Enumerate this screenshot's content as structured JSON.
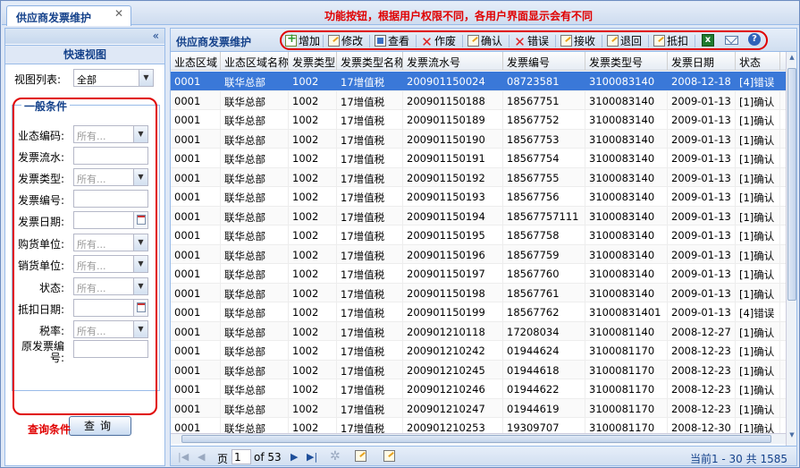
{
  "tab": {
    "title": "供应商发票维护",
    "close": "✕"
  },
  "annotations": {
    "toolbar_note": "功能按钮，根据用户权限不同，各用户界面显示会有不同",
    "query_note": "查询条件"
  },
  "left": {
    "collapse": "«",
    "quick_view_title": "快速视图",
    "view_list_label": "视图列表:",
    "view_list_value": "全部",
    "group_title": "一般条件",
    "fields": [
      {
        "label": "业态编码:",
        "type": "combo",
        "placeholder": "所有..."
      },
      {
        "label": "发票流水:",
        "type": "text"
      },
      {
        "label": "发票类型:",
        "type": "combo",
        "placeholder": "所有..."
      },
      {
        "label": "发票编号:",
        "type": "text"
      },
      {
        "label": "发票日期:",
        "type": "date"
      },
      {
        "label": "购货单位:",
        "type": "combo",
        "placeholder": "所有..."
      },
      {
        "label": "销货单位:",
        "type": "combo",
        "placeholder": "所有..."
      },
      {
        "label": "状态:",
        "type": "combo",
        "placeholder": "所有..."
      },
      {
        "label": "抵扣日期:",
        "type": "date"
      },
      {
        "label": "税率:",
        "type": "combo",
        "placeholder": "所有..."
      },
      {
        "label": "原发票编号:",
        "type": "text"
      }
    ],
    "query_button": "查询"
  },
  "toolbar": {
    "title": "供应商发票维护",
    "buttons": [
      "增加",
      "修改",
      "查看",
      "作废",
      "确认",
      "错误",
      "接收",
      "退回",
      "抵扣"
    ],
    "icons": [
      "excel-icon",
      "mail-icon",
      "help-icon"
    ]
  },
  "grid": {
    "columns": [
      "业态区域",
      "业态区域名称",
      "发票类型",
      "发票类型名称",
      "发票流水号",
      "发票编号",
      "发票类型号",
      "发票日期",
      "状态"
    ],
    "rows": [
      [
        "0001",
        "联华总部",
        "1002",
        "17增值税",
        "200901150024",
        "08723581",
        "3100083140",
        "2008-12-18",
        "[4]错误"
      ],
      [
        "0001",
        "联华总部",
        "1002",
        "17增值税",
        "200901150188",
        "18567751",
        "3100083140",
        "2009-01-13",
        "[1]确认"
      ],
      [
        "0001",
        "联华总部",
        "1002",
        "17增值税",
        "200901150189",
        "18567752",
        "3100083140",
        "2009-01-13",
        "[1]确认"
      ],
      [
        "0001",
        "联华总部",
        "1002",
        "17增值税",
        "200901150190",
        "18567753",
        "3100083140",
        "2009-01-13",
        "[1]确认"
      ],
      [
        "0001",
        "联华总部",
        "1002",
        "17增值税",
        "200901150191",
        "18567754",
        "3100083140",
        "2009-01-13",
        "[1]确认"
      ],
      [
        "0001",
        "联华总部",
        "1002",
        "17增值税",
        "200901150192",
        "18567755",
        "3100083140",
        "2009-01-13",
        "[1]确认"
      ],
      [
        "0001",
        "联华总部",
        "1002",
        "17增值税",
        "200901150193",
        "18567756",
        "3100083140",
        "2009-01-13",
        "[1]确认"
      ],
      [
        "0001",
        "联华总部",
        "1002",
        "17增值税",
        "200901150194",
        "18567757111",
        "3100083140",
        "2009-01-13",
        "[1]确认"
      ],
      [
        "0001",
        "联华总部",
        "1002",
        "17增值税",
        "200901150195",
        "18567758",
        "3100083140",
        "2009-01-13",
        "[1]确认"
      ],
      [
        "0001",
        "联华总部",
        "1002",
        "17增值税",
        "200901150196",
        "18567759",
        "3100083140",
        "2009-01-13",
        "[1]确认"
      ],
      [
        "0001",
        "联华总部",
        "1002",
        "17增值税",
        "200901150197",
        "18567760",
        "3100083140",
        "2009-01-13",
        "[1]确认"
      ],
      [
        "0001",
        "联华总部",
        "1002",
        "17增值税",
        "200901150198",
        "18567761",
        "3100083140",
        "2009-01-13",
        "[1]确认"
      ],
      [
        "0001",
        "联华总部",
        "1002",
        "17增值税",
        "200901150199",
        "18567762",
        "31000831401",
        "2009-01-13",
        "[4]错误"
      ],
      [
        "0001",
        "联华总部",
        "1002",
        "17增值税",
        "200901210118",
        "17208034",
        "3100081140",
        "2008-12-27",
        "[1]确认"
      ],
      [
        "0001",
        "联华总部",
        "1002",
        "17增值税",
        "200901210242",
        "01944624",
        "3100081170",
        "2008-12-23",
        "[1]确认"
      ],
      [
        "0001",
        "联华总部",
        "1002",
        "17增值税",
        "200901210245",
        "01944618",
        "3100081170",
        "2008-12-23",
        "[1]确认"
      ],
      [
        "0001",
        "联华总部",
        "1002",
        "17增值税",
        "200901210246",
        "01944622",
        "3100081170",
        "2008-12-23",
        "[1]确认"
      ],
      [
        "0001",
        "联华总部",
        "1002",
        "17增值税",
        "200901210247",
        "01944619",
        "3100081170",
        "2008-12-23",
        "[1]确认"
      ],
      [
        "0001",
        "联华总部",
        "1002",
        "17增值税",
        "200901210253",
        "19309707",
        "3100081170",
        "2008-12-30",
        "[1]确认"
      ]
    ],
    "selected_row": 0
  },
  "pager": {
    "page_label": "页",
    "page_value": "1",
    "of_label": "of 53",
    "info": "当前1 - 30 共 1585"
  }
}
